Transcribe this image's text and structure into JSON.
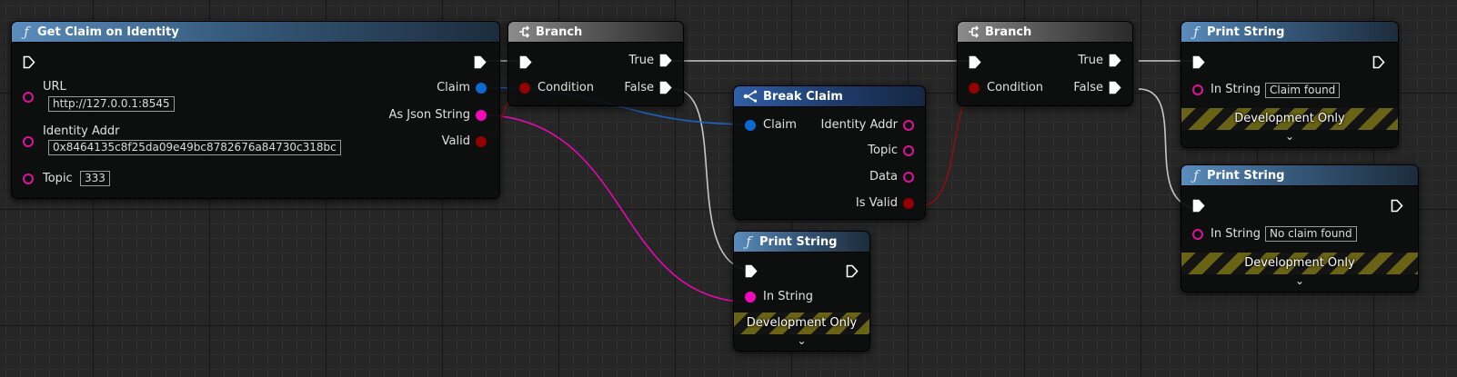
{
  "nodes": {
    "get_claim": {
      "title": "Get Claim on Identity",
      "url_label": "URL",
      "url_value": "http://127.0.0.1:8545",
      "identity_label": "Identity Addr",
      "identity_value": "0x8464135c8f25da09e49bc8782676a84730c318bc",
      "topic_label": "Topic",
      "topic_value": "333",
      "claim_out": "Claim",
      "json_out": "As Json String",
      "valid_out": "Valid"
    },
    "branch1": {
      "title": "Branch",
      "condition": "Condition",
      "true_out": "True",
      "false_out": "False"
    },
    "break_claim": {
      "title": "Break Claim",
      "claim_in": "Claim",
      "identity_out": "Identity Addr",
      "topic_out": "Topic",
      "data_out": "Data",
      "valid_out": "Is Valid"
    },
    "print_json": {
      "title": "Print String",
      "in_label": "In String",
      "dev": "Development Only"
    },
    "branch2": {
      "title": "Branch",
      "condition": "Condition",
      "true_out": "True",
      "false_out": "False"
    },
    "print_found": {
      "title": "Print String",
      "in_label": "In String",
      "in_value": "Claim found",
      "dev": "Development Only"
    },
    "print_notfound": {
      "title": "Print String",
      "in_label": "In String",
      "in_value": "No claim found",
      "dev": "Development Only"
    }
  },
  "icons": {
    "function": "function-icon",
    "branch": "branch-icon",
    "break": "break-struct-icon",
    "exec": "exec-pin-icon",
    "expand": "chevron-down-icon"
  },
  "colors": {
    "exec": "#ffffff",
    "struct": "#0a6ad4",
    "string": "#f00ab8",
    "bool": "#940000"
  }
}
